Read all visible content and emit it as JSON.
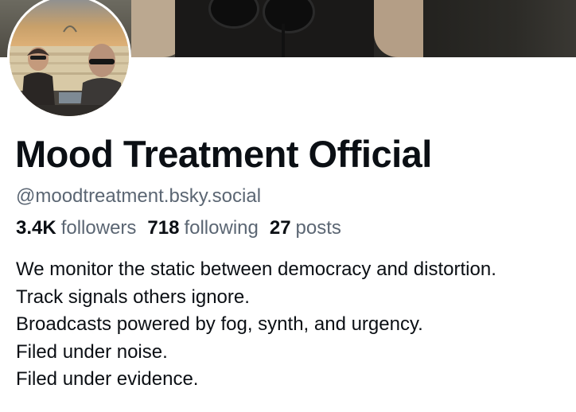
{
  "profile": {
    "display_name": "Mood Treatment Official",
    "handle": "@moodtreatment.bsky.social",
    "stats": [
      {
        "value": "3.4K",
        "label": "followers"
      },
      {
        "value": "718",
        "label": "following"
      },
      {
        "value": "27",
        "label": "posts"
      }
    ],
    "bio_lines": [
      "We monitor the static between democracy and distortion.",
      "Track signals others ignore.",
      "Broadcasts powered by fog, synth, and urgency.",
      "Filed under noise.",
      "Filed under evidence."
    ]
  },
  "colors": {
    "text_primary": "#0b0f14",
    "text_secondary": "#5b6673",
    "background": "#ffffff"
  }
}
